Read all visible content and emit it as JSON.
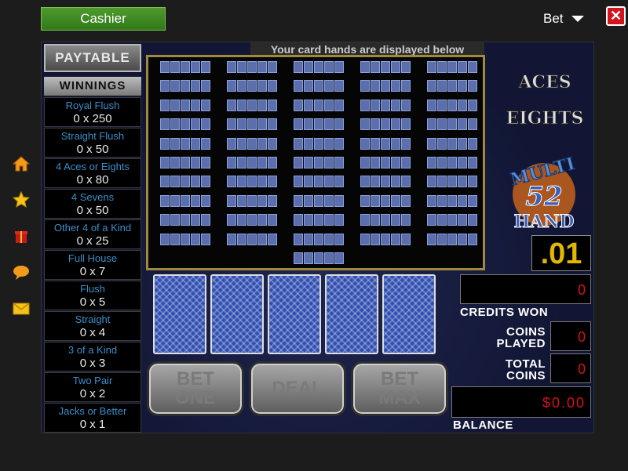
{
  "topbar": {
    "cashier_label": "Cashier",
    "bet_label": "Bet",
    "close_label": "✕"
  },
  "sidebar": [
    {
      "name": "home-icon",
      "glyph": "⌂"
    },
    {
      "name": "star-icon",
      "glyph": "★"
    },
    {
      "name": "gift-icon",
      "glyph": "🎁"
    },
    {
      "name": "chat-icon",
      "glyph": "💬"
    },
    {
      "name": "mail-icon",
      "glyph": "✉"
    }
  ],
  "paytable": {
    "button_label": "PAYTABLE",
    "header": "WINNINGS",
    "rows": [
      {
        "name": "Royal Flush",
        "value": "0 x 250"
      },
      {
        "name": "Straight Flush",
        "value": "0 x 50"
      },
      {
        "name": "4 Aces or Eights",
        "value": "0 x 80"
      },
      {
        "name": "4 Sevens",
        "value": "0 x 50"
      },
      {
        "name": "Other 4 of a Kind",
        "value": "0 x 25"
      },
      {
        "name": "Full House",
        "value": "0 x 7"
      },
      {
        "name": "Flush",
        "value": "0 x 5"
      },
      {
        "name": "Straight",
        "value": "0 x 4"
      },
      {
        "name": "3 of a Kind",
        "value": "0 x 3"
      },
      {
        "name": "Two Pair",
        "value": "0 x 2"
      },
      {
        "name": "Jacks or Better",
        "value": "0 x 1"
      }
    ]
  },
  "hands": {
    "title": "Your card hands are displayed below",
    "count": 51
  },
  "logo": {
    "line1": "ACES",
    "line2": "EIGHTS",
    "line3": "MULTI",
    "line4": "52",
    "line5": "HAND"
  },
  "denomination": ".01",
  "meters": {
    "credits_won_value": "0",
    "credits_won_label": "CREDITS WON",
    "coins_played_label": "COINS PLAYED",
    "coins_played_value": "0",
    "total_coins_label": "TOTAL COINS",
    "total_coins_value": "0",
    "balance_value": "$0.00",
    "balance_label": "BALANCE"
  },
  "buttons": {
    "bet_one": "BET ONE",
    "deal": "DEAL",
    "bet_max": "BET MAX"
  },
  "colors": {
    "accent_green": "#3f8c24",
    "close_red": "#d2141e",
    "meter_red": "#d8101c",
    "denom_gold": "#e0b800",
    "paytable_blue": "#3a8ec9"
  }
}
